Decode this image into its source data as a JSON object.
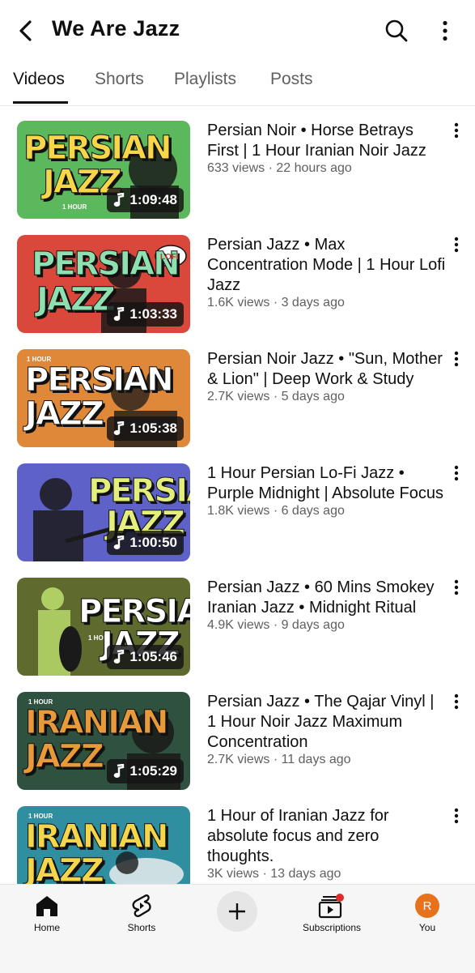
{
  "header": {
    "title": "We Are Jazz",
    "back_icon": "back-arrow-icon",
    "search_icon": "search-icon",
    "more_icon": "more-vert-icon"
  },
  "tabs": [
    {
      "label": "Videos",
      "active": true
    },
    {
      "label": "Shorts",
      "active": false
    },
    {
      "label": "Playlists",
      "active": false
    },
    {
      "label": "Posts",
      "active": false
    }
  ],
  "videos": [
    {
      "title": "Persian Noir • Horse Betrays First | 1 Hour Iranian Noir Jazz",
      "info": "633 views · 22 hours ago",
      "duration": "1:09:48",
      "thumb": {
        "line1": "PERSIAN",
        "line2": "JAZZ",
        "badge": "1 HOUR",
        "bg": "#5cb85c",
        "text_color": "#f7d64a"
      }
    },
    {
      "title": "Persian Jazz • Max Concentration Mode | 1 Hour Lofi Jazz",
      "info": "1.6K views · 3 days ago",
      "duration": "1:03:33",
      "thumb": {
        "line1": "PERSIAN",
        "line2": "JAZZ",
        "badge": "LOFI",
        "bg": "#d9483b",
        "text_color": "#8ee0b0"
      }
    },
    {
      "title": "Persian Noir Jazz • \"Sun, Mother & Lion\" | Deep Work & Study",
      "info": "2.7K views · 5 days ago",
      "duration": "1:05:38",
      "thumb": {
        "line1": "PERSIAN",
        "line2": "JAZZ",
        "badge": "1 HOUR",
        "bg": "#e0883a",
        "text_color": "#ffffff"
      }
    },
    {
      "title": "1 Hour Persian Lo-Fi Jazz • Purple Midnight | Absolute Focus",
      "info": "1.8K views · 6 days ago",
      "duration": "1:00:50",
      "thumb": {
        "line1": "PERSIAN",
        "line2": "JAZZ",
        "badge": "",
        "bg": "#5e62c8",
        "text_color": "#e3ef7a"
      }
    },
    {
      "title": "Persian Jazz • 60 Mins Smokey Iranian Jazz • Midnight Ritual",
      "info": "4.9K views · 9 days ago",
      "duration": "1:05:46",
      "thumb": {
        "line1": "PERSIAN",
        "line2": "JAZZ",
        "badge": "1 HOUR",
        "bg": "#5e6a2e",
        "text_color": "#ffffff"
      }
    },
    {
      "title": "Persian Jazz • The Qajar Vinyl | 1 Hour Noir Jazz Maximum Concentration",
      "info": "2.7K views · 11 days ago",
      "duration": "1:05:29",
      "thumb": {
        "line1": "IRANIAN",
        "line2": "JAZZ",
        "badge": "1 HOUR",
        "bg": "#2f5140",
        "text_color": "#e89a3a"
      }
    },
    {
      "title": "1 Hour of Iranian Jazz for absolute focus and zero thoughts.",
      "info": "3K views · 13 days ago",
      "duration": "",
      "thumb": {
        "line1": "IRANIAN",
        "line2": "JAZZ",
        "badge": "1 HOUR",
        "bg": "#2f8fa0",
        "text_color": "#f5d64a"
      }
    }
  ],
  "bottom_nav": {
    "home": {
      "label": "Home",
      "icon": "home-icon"
    },
    "shorts": {
      "label": "Shorts",
      "icon": "shorts-icon"
    },
    "create": {
      "icon": "plus-icon"
    },
    "subscriptions": {
      "label": "Subscriptions",
      "icon": "subscriptions-icon",
      "has_notification": true
    },
    "you": {
      "label": "You",
      "avatar_letter": "R",
      "avatar_color": "#e8711c"
    }
  }
}
